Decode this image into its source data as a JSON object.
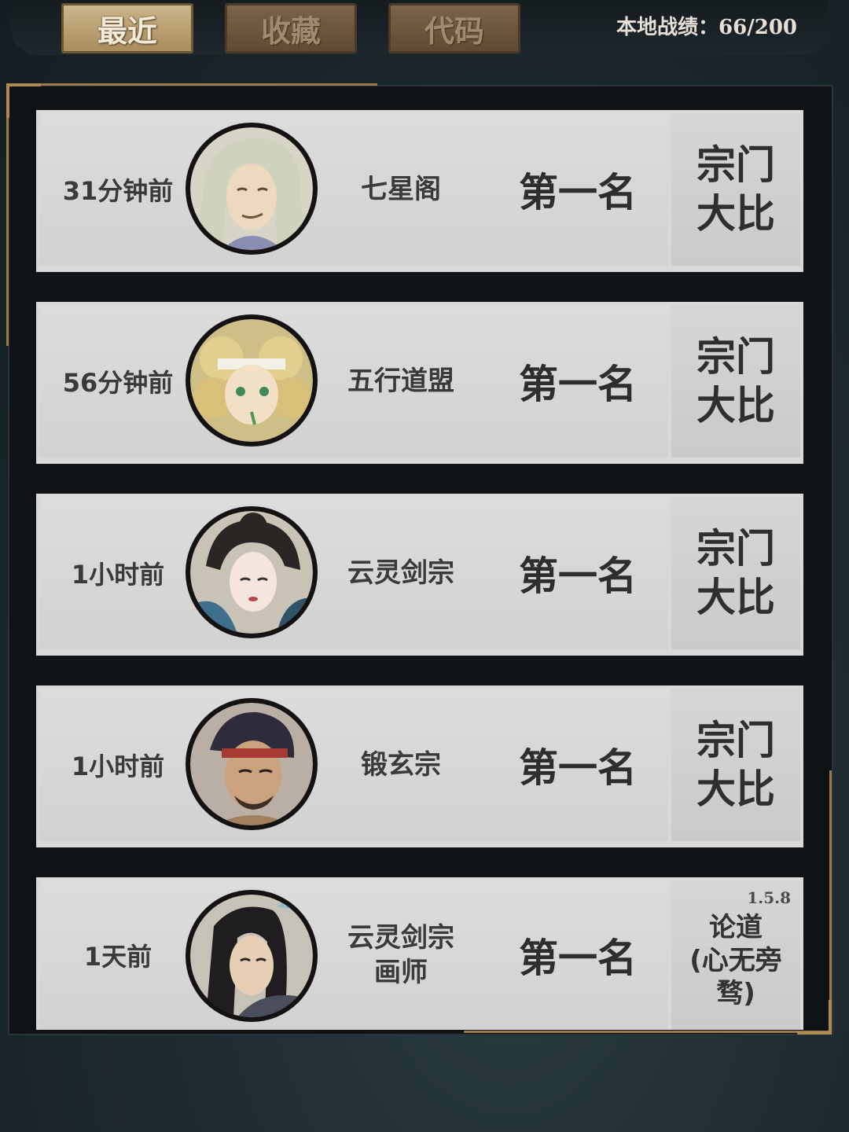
{
  "tabs": [
    {
      "label": "最近",
      "active": true
    },
    {
      "label": "收藏",
      "active": false
    },
    {
      "label": "代码",
      "active": false
    }
  ],
  "stats": "本地战绩：66/200",
  "records": [
    {
      "time": "31分钟前",
      "sect": "七星阁",
      "rank": "第一名",
      "mode": "宗门\n大比",
      "avatar": "white-haired-elder-avatar"
    },
    {
      "time": "56分钟前",
      "sect": "五行道盟",
      "rank": "第一名",
      "mode": "宗门\n大比",
      "avatar": "blonde-curly-hair-avatar"
    },
    {
      "time": "1小时前",
      "sect": "云灵剑宗",
      "rank": "第一名",
      "mode": "宗门\n大比",
      "avatar": "dark-haired-lady-avatar"
    },
    {
      "time": "1小时前",
      "sect": "锻玄宗",
      "rank": "第一名",
      "mode": "宗门\n大比",
      "avatar": "headband-warrior-avatar"
    },
    {
      "time": "1天前",
      "sect": "云灵剑宗\n画师",
      "rank": "第一名",
      "mode": "论道\n(心无旁\n骛)",
      "version": "1.5.8",
      "avatar": "long-haired-swordsman-avatar"
    }
  ],
  "colors": {
    "accent": "#b08a55",
    "row_bg": "#d9d9d9"
  }
}
